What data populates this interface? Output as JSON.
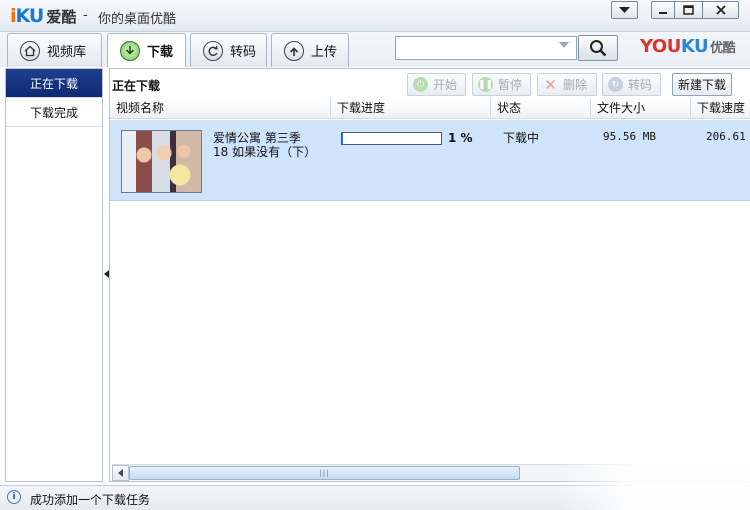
{
  "window": {
    "logo_mark_i": "i",
    "logo_mark_ku": "KU",
    "logo_cn": "爱酷",
    "title_dash": "-",
    "title_sub": "你的桌面优酷"
  },
  "tabs": [
    {
      "label": "视频库",
      "icon": "home-icon"
    },
    {
      "label": "下载",
      "icon": "download-icon"
    },
    {
      "label": "转码",
      "icon": "transcode-icon"
    },
    {
      "label": "上传",
      "icon": "upload-icon"
    }
  ],
  "search": {
    "value": "",
    "placeholder": ""
  },
  "brand": {
    "you": "YOU",
    "ku": "KU",
    "cn": "优酷"
  },
  "sidebar": {
    "items": [
      {
        "label": "正在下载",
        "active": true
      },
      {
        "label": "下载完成",
        "active": false
      }
    ]
  },
  "main": {
    "title": "正在下载",
    "actions": {
      "start": "开始",
      "pause": "暂停",
      "delete": "删除",
      "transcode": "转码",
      "new_download": "新建下载"
    },
    "columns": {
      "name": "视频名称",
      "progress": "下载进度",
      "state": "状态",
      "size": "文件大小",
      "speed": "下载速度"
    },
    "rows": [
      {
        "title_line1": "爱情公寓 第三季",
        "title_line2": "18 如果没有（下）",
        "progress_fraction": 0.01,
        "progress_text": "1 %",
        "state": "下载中",
        "size": "95.56 MB",
        "speed": "206.61"
      }
    ],
    "scroll_grip": "|||"
  },
  "status": {
    "text": "成功添加一个下载任务"
  },
  "colors": {
    "accent_active": "#0d2a73",
    "progress": "#2c7be0",
    "row_selected": "#cfe3fb"
  }
}
